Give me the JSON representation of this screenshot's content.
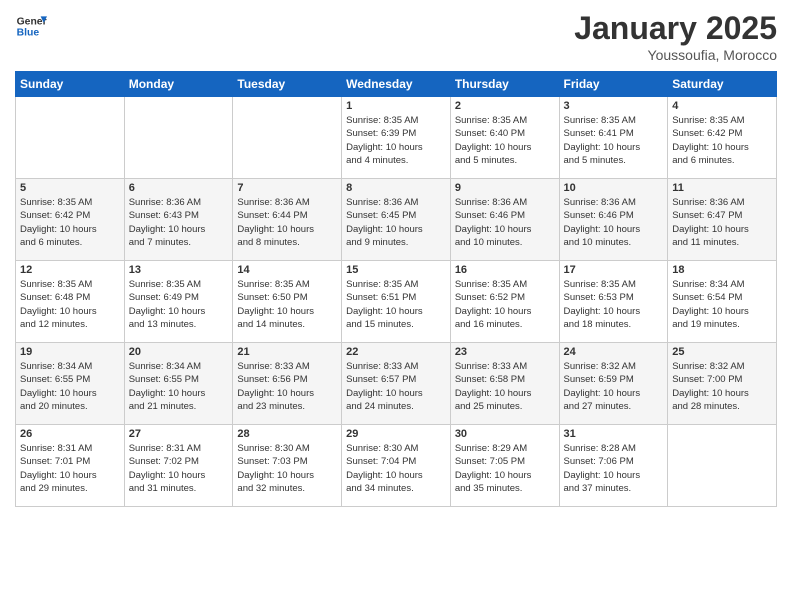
{
  "logo": {
    "line1": "General",
    "line2": "Blue"
  },
  "title": "January 2025",
  "subtitle": "Youssoufia, Morocco",
  "days_of_week": [
    "Sunday",
    "Monday",
    "Tuesday",
    "Wednesday",
    "Thursday",
    "Friday",
    "Saturday"
  ],
  "weeks": [
    [
      {
        "day": "",
        "info": ""
      },
      {
        "day": "",
        "info": ""
      },
      {
        "day": "",
        "info": ""
      },
      {
        "day": "1",
        "info": "Sunrise: 8:35 AM\nSunset: 6:39 PM\nDaylight: 10 hours\nand 4 minutes."
      },
      {
        "day": "2",
        "info": "Sunrise: 8:35 AM\nSunset: 6:40 PM\nDaylight: 10 hours\nand 5 minutes."
      },
      {
        "day": "3",
        "info": "Sunrise: 8:35 AM\nSunset: 6:41 PM\nDaylight: 10 hours\nand 5 minutes."
      },
      {
        "day": "4",
        "info": "Sunrise: 8:35 AM\nSunset: 6:42 PM\nDaylight: 10 hours\nand 6 minutes."
      }
    ],
    [
      {
        "day": "5",
        "info": "Sunrise: 8:35 AM\nSunset: 6:42 PM\nDaylight: 10 hours\nand 6 minutes."
      },
      {
        "day": "6",
        "info": "Sunrise: 8:36 AM\nSunset: 6:43 PM\nDaylight: 10 hours\nand 7 minutes."
      },
      {
        "day": "7",
        "info": "Sunrise: 8:36 AM\nSunset: 6:44 PM\nDaylight: 10 hours\nand 8 minutes."
      },
      {
        "day": "8",
        "info": "Sunrise: 8:36 AM\nSunset: 6:45 PM\nDaylight: 10 hours\nand 9 minutes."
      },
      {
        "day": "9",
        "info": "Sunrise: 8:36 AM\nSunset: 6:46 PM\nDaylight: 10 hours\nand 10 minutes."
      },
      {
        "day": "10",
        "info": "Sunrise: 8:36 AM\nSunset: 6:46 PM\nDaylight: 10 hours\nand 10 minutes."
      },
      {
        "day": "11",
        "info": "Sunrise: 8:36 AM\nSunset: 6:47 PM\nDaylight: 10 hours\nand 11 minutes."
      }
    ],
    [
      {
        "day": "12",
        "info": "Sunrise: 8:35 AM\nSunset: 6:48 PM\nDaylight: 10 hours\nand 12 minutes."
      },
      {
        "day": "13",
        "info": "Sunrise: 8:35 AM\nSunset: 6:49 PM\nDaylight: 10 hours\nand 13 minutes."
      },
      {
        "day": "14",
        "info": "Sunrise: 8:35 AM\nSunset: 6:50 PM\nDaylight: 10 hours\nand 14 minutes."
      },
      {
        "day": "15",
        "info": "Sunrise: 8:35 AM\nSunset: 6:51 PM\nDaylight: 10 hours\nand 15 minutes."
      },
      {
        "day": "16",
        "info": "Sunrise: 8:35 AM\nSunset: 6:52 PM\nDaylight: 10 hours\nand 16 minutes."
      },
      {
        "day": "17",
        "info": "Sunrise: 8:35 AM\nSunset: 6:53 PM\nDaylight: 10 hours\nand 18 minutes."
      },
      {
        "day": "18",
        "info": "Sunrise: 8:34 AM\nSunset: 6:54 PM\nDaylight: 10 hours\nand 19 minutes."
      }
    ],
    [
      {
        "day": "19",
        "info": "Sunrise: 8:34 AM\nSunset: 6:55 PM\nDaylight: 10 hours\nand 20 minutes."
      },
      {
        "day": "20",
        "info": "Sunrise: 8:34 AM\nSunset: 6:55 PM\nDaylight: 10 hours\nand 21 minutes."
      },
      {
        "day": "21",
        "info": "Sunrise: 8:33 AM\nSunset: 6:56 PM\nDaylight: 10 hours\nand 23 minutes."
      },
      {
        "day": "22",
        "info": "Sunrise: 8:33 AM\nSunset: 6:57 PM\nDaylight: 10 hours\nand 24 minutes."
      },
      {
        "day": "23",
        "info": "Sunrise: 8:33 AM\nSunset: 6:58 PM\nDaylight: 10 hours\nand 25 minutes."
      },
      {
        "day": "24",
        "info": "Sunrise: 8:32 AM\nSunset: 6:59 PM\nDaylight: 10 hours\nand 27 minutes."
      },
      {
        "day": "25",
        "info": "Sunrise: 8:32 AM\nSunset: 7:00 PM\nDaylight: 10 hours\nand 28 minutes."
      }
    ],
    [
      {
        "day": "26",
        "info": "Sunrise: 8:31 AM\nSunset: 7:01 PM\nDaylight: 10 hours\nand 29 minutes."
      },
      {
        "day": "27",
        "info": "Sunrise: 8:31 AM\nSunset: 7:02 PM\nDaylight: 10 hours\nand 31 minutes."
      },
      {
        "day": "28",
        "info": "Sunrise: 8:30 AM\nSunset: 7:03 PM\nDaylight: 10 hours\nand 32 minutes."
      },
      {
        "day": "29",
        "info": "Sunrise: 8:30 AM\nSunset: 7:04 PM\nDaylight: 10 hours\nand 34 minutes."
      },
      {
        "day": "30",
        "info": "Sunrise: 8:29 AM\nSunset: 7:05 PM\nDaylight: 10 hours\nand 35 minutes."
      },
      {
        "day": "31",
        "info": "Sunrise: 8:28 AM\nSunset: 7:06 PM\nDaylight: 10 hours\nand 37 minutes."
      },
      {
        "day": "",
        "info": ""
      }
    ]
  ]
}
